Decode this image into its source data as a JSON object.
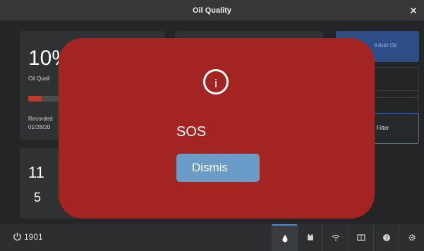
{
  "window": {
    "title": "Oil Quality"
  },
  "oil_card": {
    "percent": "10%",
    "label": "Oil Quali",
    "level_fraction": 0.12,
    "recorded_label": "Recorded",
    "recorded_date": "01/28/20"
  },
  "bottom_card": {
    "line1": "11",
    "line2": "5"
  },
  "right_buttons": {
    "add_oil": "il Add Oil",
    "filter": "d Filter"
  },
  "status_bar": {
    "power_value": "1901"
  },
  "tabs": [
    "oil-drop-icon",
    "fryer-icon",
    "wifi-icon",
    "manual-icon",
    "help-icon",
    "settings-icon"
  ],
  "dialog": {
    "icon_glyph": "i",
    "message": "SOS",
    "dismiss_label": "Dismis"
  },
  "colors": {
    "dialog": "#a32420",
    "dismiss": "#6b9bc7",
    "accent": "#4d8ad6"
  }
}
